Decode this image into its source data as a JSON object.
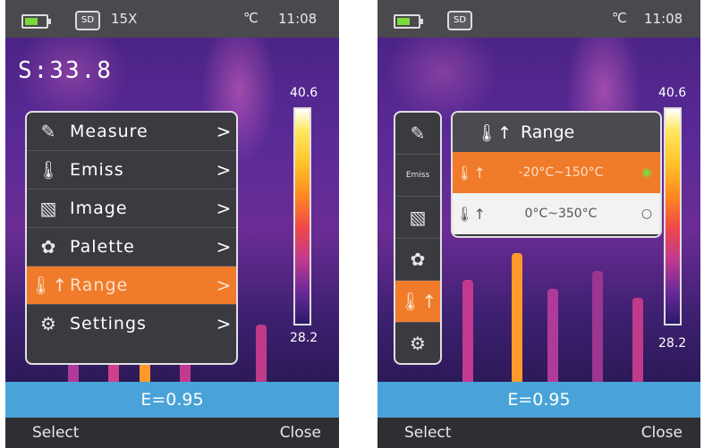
{
  "left_screen": {
    "status": {
      "sd_label": "SD",
      "zoom": "15X",
      "temp_unit": "℃",
      "time": "11:08"
    },
    "spot_reading": "S:33.8",
    "scale": {
      "max": "40.6",
      "min": "28.2"
    },
    "menu": [
      {
        "icon": "measure-icon",
        "label": "Measure",
        "arrow": ">"
      },
      {
        "icon": "thermometer-icon",
        "label": "Emiss",
        "arrow": ">"
      },
      {
        "icon": "image-icon",
        "label": "Image",
        "arrow": ">"
      },
      {
        "icon": "palette-icon",
        "label": "Palette",
        "arrow": ">"
      },
      {
        "icon": "range-icon",
        "label": "Range",
        "arrow": ">",
        "selected": true
      },
      {
        "icon": "settings-icon",
        "label": "Settings",
        "arrow": ">"
      }
    ],
    "emissivity": "E=0.95",
    "softkeys": {
      "left": "Select",
      "right": "Close"
    }
  },
  "right_screen": {
    "status": {
      "sd_label": "SD",
      "temp_unit": "℃",
      "time": "11:08"
    },
    "scale": {
      "max": "40.6",
      "min": "28.2"
    },
    "sidebar_small_label": "Emiss",
    "submenu": {
      "title": "Range",
      "options": [
        {
          "label": "-20°C~150°C",
          "selected": true
        },
        {
          "label": "0°C~350°C",
          "selected": false
        }
      ]
    },
    "emissivity": "E=0.95",
    "softkeys": {
      "left": "Select",
      "right": "Close"
    }
  },
  "colors": {
    "accent": "#f07b2b",
    "info_bar": "#4aa3d8",
    "status_bar": "#4a4a4e",
    "radio_on": "#7bd93a"
  }
}
